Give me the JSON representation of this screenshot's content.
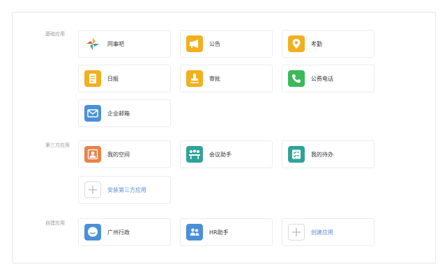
{
  "sections": {
    "basic": {
      "title": "基础应用",
      "apps": [
        {
          "label": "同事吧",
          "icon": "pinwheel-icon",
          "color": "#ffffff"
        },
        {
          "label": "公告",
          "icon": "megaphone-icon",
          "color": "#f2b01e"
        },
        {
          "label": "考勤",
          "icon": "location-pin-icon",
          "color": "#f2b01e"
        },
        {
          "label": "日报",
          "icon": "document-icon",
          "color": "#f2b01e"
        },
        {
          "label": "审批",
          "icon": "stamp-icon",
          "color": "#f2b01e"
        },
        {
          "label": "公费电话",
          "icon": "phone-icon",
          "color": "#3cb95a"
        },
        {
          "label": "企业邮箱",
          "icon": "mail-icon",
          "color": "#4a90d9"
        }
      ]
    },
    "third_party": {
      "title": "第三方应用",
      "apps": [
        {
          "label": "我的空间",
          "icon": "user-space-icon",
          "color": "#e8834a"
        },
        {
          "label": "会议助手",
          "icon": "meeting-icon",
          "color": "#2fa39a"
        },
        {
          "label": "我的待办",
          "icon": "todo-icon",
          "color": "#2fa39a"
        }
      ],
      "add_label": "安装第三方应用"
    },
    "custom": {
      "title": "自建应用",
      "apps": [
        {
          "label": "广州行政",
          "icon": "chat-bubble-icon",
          "color": "#4a90d9"
        },
        {
          "label": "HR助手",
          "icon": "hr-people-icon",
          "color": "#4a90d9"
        }
      ],
      "add_label": "创建应用"
    }
  }
}
